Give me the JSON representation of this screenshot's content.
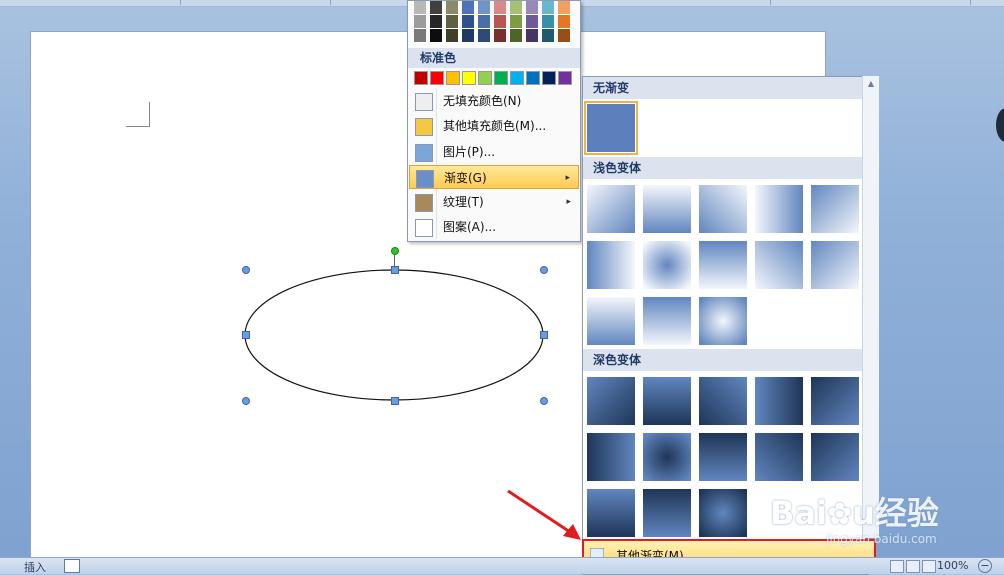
{
  "fill_menu": {
    "shade_colors": [
      [
        "#b8b8b8",
        "#9c9c9c",
        "#7a7a7a"
      ],
      [
        "#404040",
        "#262626",
        "#0d0d0d"
      ],
      [
        "#8a8a6a",
        "#5f5f44",
        "#3e3e2a"
      ],
      [
        "#4f73b8",
        "#2f528f",
        "#1f3864"
      ],
      [
        "#6f94c8",
        "#4a6fa8",
        "#2d4a78"
      ],
      [
        "#d88a88",
        "#b85654",
        "#7a2f2d"
      ],
      [
        "#a9bf78",
        "#7d9a45",
        "#4f6527"
      ],
      [
        "#9b88b8",
        "#6f5a96",
        "#453563"
      ],
      [
        "#6ab6cc",
        "#3a8ea8",
        "#215a6c"
      ],
      [
        "#f2a060",
        "#e37725",
        "#974f15"
      ]
    ],
    "standard_colors_label": "标准色",
    "standard_colors": [
      "#c00000",
      "#ff0000",
      "#ffc000",
      "#ffff00",
      "#92d050",
      "#00b050",
      "#00b0f0",
      "#0070c0",
      "#002060",
      "#7030a0"
    ],
    "items": [
      {
        "label": "无填充颜色(N)",
        "icon": "no-fill-icon",
        "arrow": ""
      },
      {
        "label": "其他填充颜色(M)...",
        "icon": "palette-icon",
        "arrow": ""
      },
      {
        "label": "图片(P)...",
        "icon": "picture-icon",
        "arrow": ""
      },
      {
        "label": "渐变(G)",
        "icon": "gradient-icon",
        "arrow": "▸"
      },
      {
        "label": "纹理(T)",
        "icon": "texture-icon",
        "arrow": "▸"
      },
      {
        "label": "图案(A)...",
        "icon": "pattern-icon",
        "arrow": ""
      }
    ]
  },
  "gradient_menu": {
    "no_gradient_label": "无渐变",
    "light_variations_label": "浅色变体",
    "dark_variations_label": "深色变体",
    "more_gradients_label": "其他渐变(M)...",
    "base_color": "#6186bf",
    "light_color": "#f4f7fc",
    "dark_color": "#1e3557",
    "scroll_up": "▲"
  },
  "status_bar": {
    "insert_label": "插入",
    "zoom_label": "100%",
    "zoom_out": "−"
  },
  "watermark": {
    "brand": "Bai",
    "brand_end": "u",
    "cn": "经验",
    "url": "jingyan.baidu.com"
  },
  "colors": {
    "highlight": "#ffcb52",
    "annotation_red": "#e11c1c"
  }
}
